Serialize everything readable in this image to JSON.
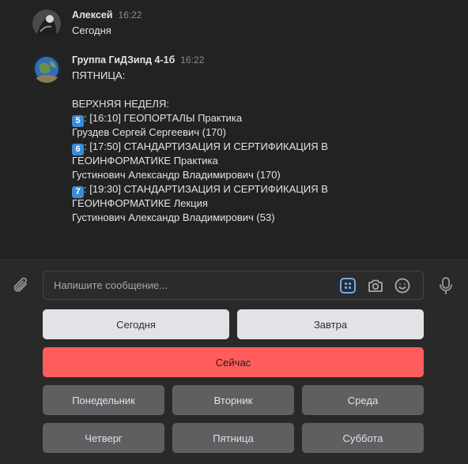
{
  "messages": [
    {
      "author": "Алексей",
      "time": "16:22",
      "lines": [
        "Сегодня"
      ]
    },
    {
      "author": "Группа ГиДЗипд 4-1б",
      "time": "16:22",
      "line1": "ПЯТНИЦА:",
      "line2": "",
      "line3": "ВЕРХНЯЯ НЕДЕЛЯ:",
      "badge5": "5",
      "line4": ": [16:10] ГЕОПОРТАЛЫ Практика",
      "line5": "Груздев Сергей Сергеевич (170)",
      "badge6": "6",
      "line6": ": [17:50] СТАНДАРТИЗАЦИЯ И СЕРТИФИКАЦИЯ В",
      "line7": "ГЕОИНФОРМАТИКЕ Практика",
      "line8": "Густинович Александр Владимирович (170)",
      "badge7": "7",
      "line9": ": [19:30] СТАНДАРТИЗАЦИЯ И СЕРТИФИКАЦИЯ В",
      "line10": "ГЕОИНФОРМАТИКЕ Лекция",
      "line11": "Густинович Александр Владимирович (53)"
    }
  ],
  "composer": {
    "placeholder": "Напишите сообщение...",
    "value": ""
  },
  "icons": {
    "attach": "paperclip-icon",
    "bot_keyboard": "bot-keyboard-icon",
    "camera": "camera-icon",
    "emoji": "emoji-icon",
    "mic": "microphone-icon"
  },
  "keyboard": {
    "row1": [
      "Сегодня",
      "Завтра"
    ],
    "row2": [
      "Сейчас"
    ],
    "row3": [
      "Понедельник",
      "Вторник",
      "Среда"
    ],
    "row4": [
      "Четверг",
      "Пятница",
      "Суббота"
    ]
  },
  "colors": {
    "background": "#222222",
    "panel": "#292929",
    "button_light": "#e1e3e6",
    "button_accent": "#ff5c5c",
    "button_dark": "#5d5f61",
    "badge": "#3b8cd8",
    "keyboard_icon": "#71aaeb"
  }
}
